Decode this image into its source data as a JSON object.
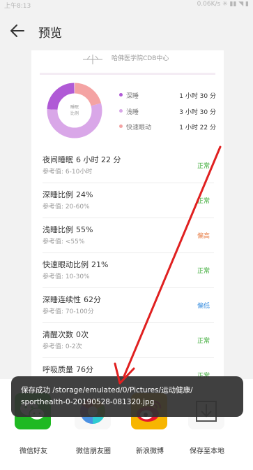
{
  "status_bar": {
    "time": "上午8:13",
    "right": "0.06K/s ✳ ▮▮ ◥ ▮"
  },
  "app_bar": {
    "title": "预览"
  },
  "report": {
    "header_text": "哈佛医学院CDB中心",
    "donut_center_label_1": "睡眠",
    "donut_center_label_2": "比例",
    "legend": [
      {
        "name": "深睡",
        "value": "1 小时 30 分",
        "color": "#b05ad6"
      },
      {
        "name": "浅睡",
        "value": "3 小时 30 分",
        "color": "#d9a7e8"
      },
      {
        "name": "快速眼动",
        "value": "1 小时 22 分",
        "color": "#f4a3a3"
      }
    ],
    "metrics": [
      {
        "title": "夜间睡眠",
        "value": "6 小时 22 分",
        "ref": "参考值: 6-10小时",
        "status": "正常",
        "status_color": "#3aaa35"
      },
      {
        "title": "深睡比例",
        "value": "24%",
        "ref": "参考值: 20-60%",
        "status": "正常",
        "status_color": "#3aaa35"
      },
      {
        "title": "浅睡比例",
        "value": "55%",
        "ref": "参考值: <55%",
        "status": "偏高",
        "status_color": "#e8804a"
      },
      {
        "title": "快速眼动比例",
        "value": "21%",
        "ref": "参考值: 10-30%",
        "status": "正常",
        "status_color": "#3aaa35"
      },
      {
        "title": "深睡连续性",
        "value": "62分",
        "ref": "参考值: 70-100分",
        "status": "偏低",
        "status_color": "#3b8fe0"
      },
      {
        "title": "清醒次数",
        "value": "0次",
        "ref": "参考值: 0-2次",
        "status": "正常",
        "status_color": "#3aaa35"
      },
      {
        "title": "呼吸质量",
        "value": "76分",
        "ref": "",
        "status": "正常",
        "status_color": "#3aaa35"
      }
    ]
  },
  "toast": {
    "line1": "保存成功 /storage/emulated/0/Pictures/运动健康/",
    "line2": "sporthealth-0-20190528-081320.jpg"
  },
  "share": [
    {
      "label": "微信好友",
      "icon": "wechat-icon"
    },
    {
      "label": "微信朋友圈",
      "icon": "moments-icon"
    },
    {
      "label": "新浪微博",
      "icon": "weibo-icon"
    },
    {
      "label": "保存至本地",
      "icon": "save-local-icon"
    }
  ]
}
